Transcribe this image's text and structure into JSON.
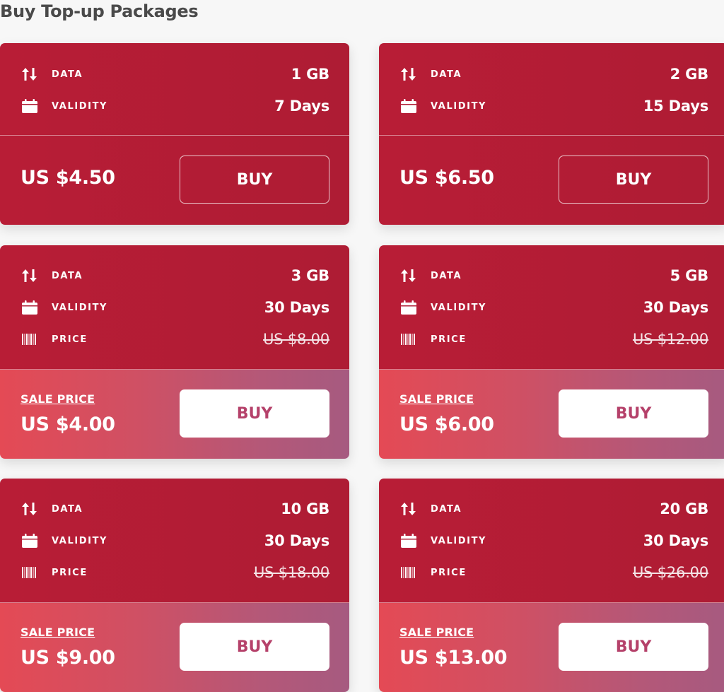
{
  "page": {
    "title": "Buy Top-up Packages"
  },
  "labels": {
    "data": "DATA",
    "validity": "VALIDITY",
    "price": "PRICE",
    "sale_price": "SALE PRICE",
    "buy": "BUY"
  },
  "icons": {
    "data": "arrows-up-down-icon",
    "validity": "calendar-icon",
    "price": "barcode-icon"
  },
  "colors": {
    "card_red": "#b01e35",
    "sale_gradient_start": "#e44a55",
    "sale_gradient_end": "#a65a80",
    "buy_text_sale": "#b5416a"
  },
  "packages": [
    {
      "data": "1 GB",
      "validity": "7 Days",
      "price": "US $4.50"
    },
    {
      "data": "2 GB",
      "validity": "15 Days",
      "price": "US $6.50"
    },
    {
      "data": "3 GB",
      "validity": "30 Days",
      "original_price": "US $8.00",
      "sale_price": "US $4.00"
    },
    {
      "data": "5 GB",
      "validity": "30 Days",
      "original_price": "US $12.00",
      "sale_price": "US $6.00"
    },
    {
      "data": "10 GB",
      "validity": "30 Days",
      "original_price": "US $18.00",
      "sale_price": "US $9.00"
    },
    {
      "data": "20 GB",
      "validity": "30 Days",
      "original_price": "US $26.00",
      "sale_price": "US $13.00"
    }
  ]
}
